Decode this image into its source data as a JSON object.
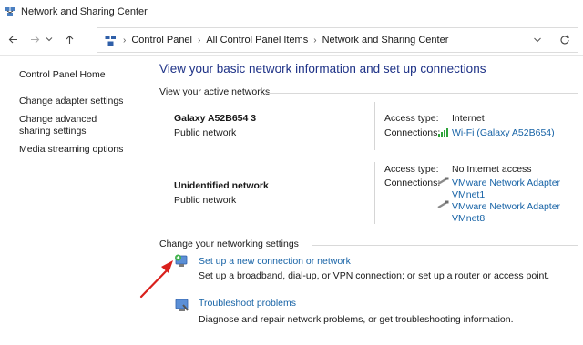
{
  "window": {
    "title": "Network and Sharing Center"
  },
  "address_bar": {
    "breadcrumbs": [
      "Control Panel",
      "All Control Panel Items",
      "Network and Sharing Center"
    ]
  },
  "sidebar": {
    "items": [
      {
        "label": "Control Panel Home"
      },
      {
        "label": "Change adapter settings"
      },
      {
        "label": "Change advanced sharing settings"
      },
      {
        "label": "Media streaming options"
      }
    ]
  },
  "main": {
    "title": "View your basic network information and set up connections",
    "active_networks_label": "View your active networks",
    "networks": [
      {
        "name": "Galaxy A52B654 3",
        "type": "Public network",
        "access_type_label": "Access type:",
        "access_type": "Internet",
        "connections_label": "Connections:",
        "connection": "Wi-Fi (Galaxy A52B654)"
      },
      {
        "name": "Unidentified network",
        "type": "Public network",
        "access_type_label": "Access type:",
        "access_type": "No Internet access",
        "connections_label": "Connections:",
        "connection_1_line1": "VMware Network Adapter",
        "connection_1_line2": "VMnet1",
        "connection_2_line1": "VMware Network Adapter",
        "connection_2_line2": "VMnet8"
      }
    ],
    "settings_label": "Change your networking settings",
    "tasks": [
      {
        "link": "Set up a new connection or network",
        "description": "Set up a broadband, dial-up, or VPN connection; or set up a router or access point."
      },
      {
        "link": "Troubleshoot problems",
        "description": "Diagnose and repair network problems, or get troubleshooting information."
      }
    ]
  },
  "colors": {
    "link": "#1763a6",
    "title": "#1e3287",
    "annotation_arrow": "#d9201c"
  }
}
